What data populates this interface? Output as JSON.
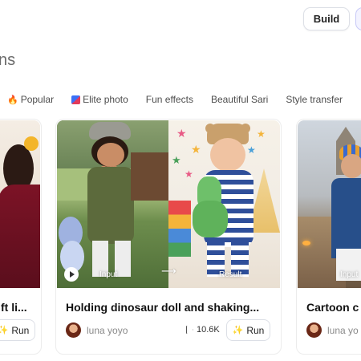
{
  "header": {
    "build_label": "Build"
  },
  "section": {
    "title": "ns"
  },
  "tabs": [
    {
      "label": "Popular",
      "icon": "fire-icon"
    },
    {
      "label": "Elite photo",
      "icon": "elite-photo-icon"
    },
    {
      "label": "Fun effects"
    },
    {
      "label": "Beautiful Sari"
    },
    {
      "label": "Style transfer"
    }
  ],
  "cards": {
    "left": {
      "title": "ft li...",
      "run_label": "Run"
    },
    "mid": {
      "title": "Holding dinosaur doll and shaking...",
      "author": "luna yoyo",
      "runs": "10.6K",
      "run_label": "Run",
      "input_label": "Input",
      "result_label": "Result"
    },
    "right": {
      "title": "Cartoon c",
      "author": "luna yo",
      "input_label": "Input"
    }
  },
  "colors": {
    "accent_fire": "#f06a1c",
    "text_muted": "#8a8a8a",
    "border": "#dcdfe6"
  }
}
